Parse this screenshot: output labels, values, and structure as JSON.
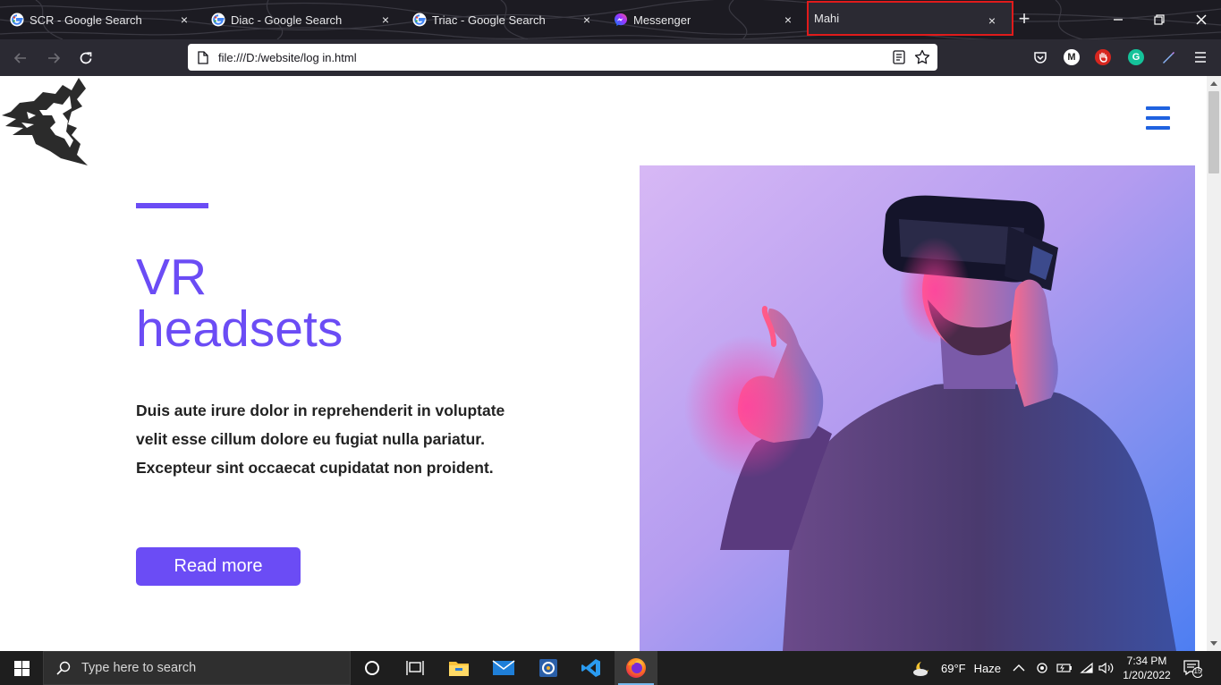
{
  "browser": {
    "tabs": [
      {
        "title": "SCR - Google Search",
        "favicon": "google-icon",
        "active": false
      },
      {
        "title": "Diac - Google Search",
        "favicon": "google-icon",
        "active": false
      },
      {
        "title": "Triac - Google Search",
        "favicon": "google-icon",
        "active": false
      },
      {
        "title": "Messenger",
        "favicon": "messenger-icon",
        "active": false
      },
      {
        "title": "Mahi",
        "favicon": "",
        "active": true
      }
    ],
    "close_glyph": "×",
    "new_tab_glyph": "+",
    "url": "file:///D:/website/log in.html",
    "extensions": [
      {
        "name": "pocket-icon"
      },
      {
        "name": "m-extension-icon",
        "letter": "M"
      },
      {
        "name": "hand-block-icon"
      },
      {
        "name": "grammarly-icon",
        "letter": "G"
      },
      {
        "name": "pen-icon"
      }
    ],
    "accent_highlight_color": "#e01b1b"
  },
  "page": {
    "hero": {
      "title_line1": "VR",
      "title_line2": "headsets",
      "text_line1": "Duis aute irure dolor in reprehenderit in voluptate",
      "text_line2": "velit esse cillum dolore eu fugiat nulla pariatur.",
      "text_line3": "Excepteur sint occaecat cupidatat non proident.",
      "button_label": "Read more"
    },
    "colors": {
      "accent": "#6b4cf5",
      "menu": "#1f62e0"
    }
  },
  "taskbar": {
    "search_placeholder": "Type here to search",
    "weather_temp": "69°F",
    "weather_desc": "Haze",
    "time": "7:34 PM",
    "date": "1/20/2022",
    "notification_count": "15"
  }
}
